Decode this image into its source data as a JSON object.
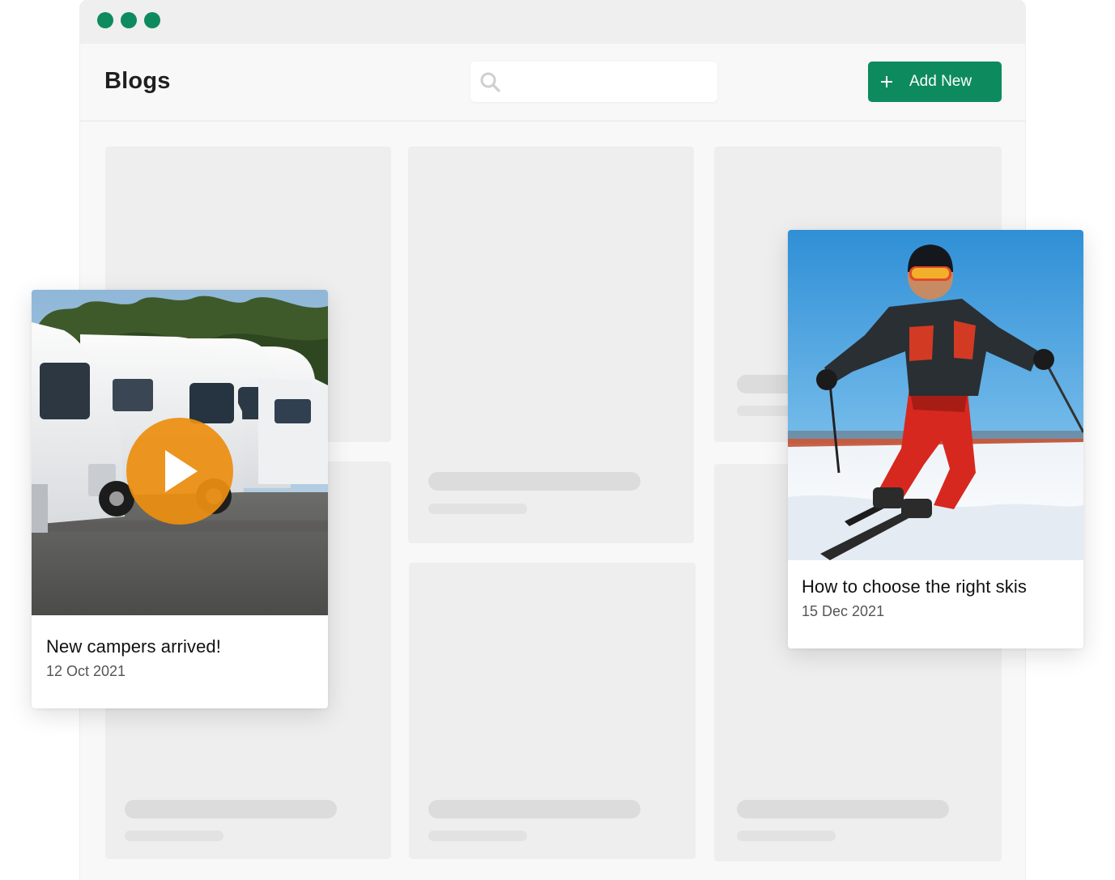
{
  "window": {
    "traffic_light_color": "#0e8a5f"
  },
  "header": {
    "title": "Blogs",
    "search": {
      "placeholder": "",
      "value": "",
      "icon": "search-icon"
    },
    "add_button": {
      "icon": "plus-icon",
      "label": "Add New",
      "color": "#0e8a5f"
    }
  },
  "posts": [
    {
      "title": "New campers arrived!",
      "date": "12 Oct 2021",
      "media": "video",
      "overlay_icon": "play-icon",
      "overlay_color": "#ec8e10"
    },
    {
      "title": "How to choose the right skis",
      "date": "15 Dec 2021",
      "media": "image"
    }
  ],
  "colors": {
    "accent": "#0e8a5f",
    "skeleton": "#eeeeee",
    "skeleton_bar": "#dcdcdc"
  }
}
